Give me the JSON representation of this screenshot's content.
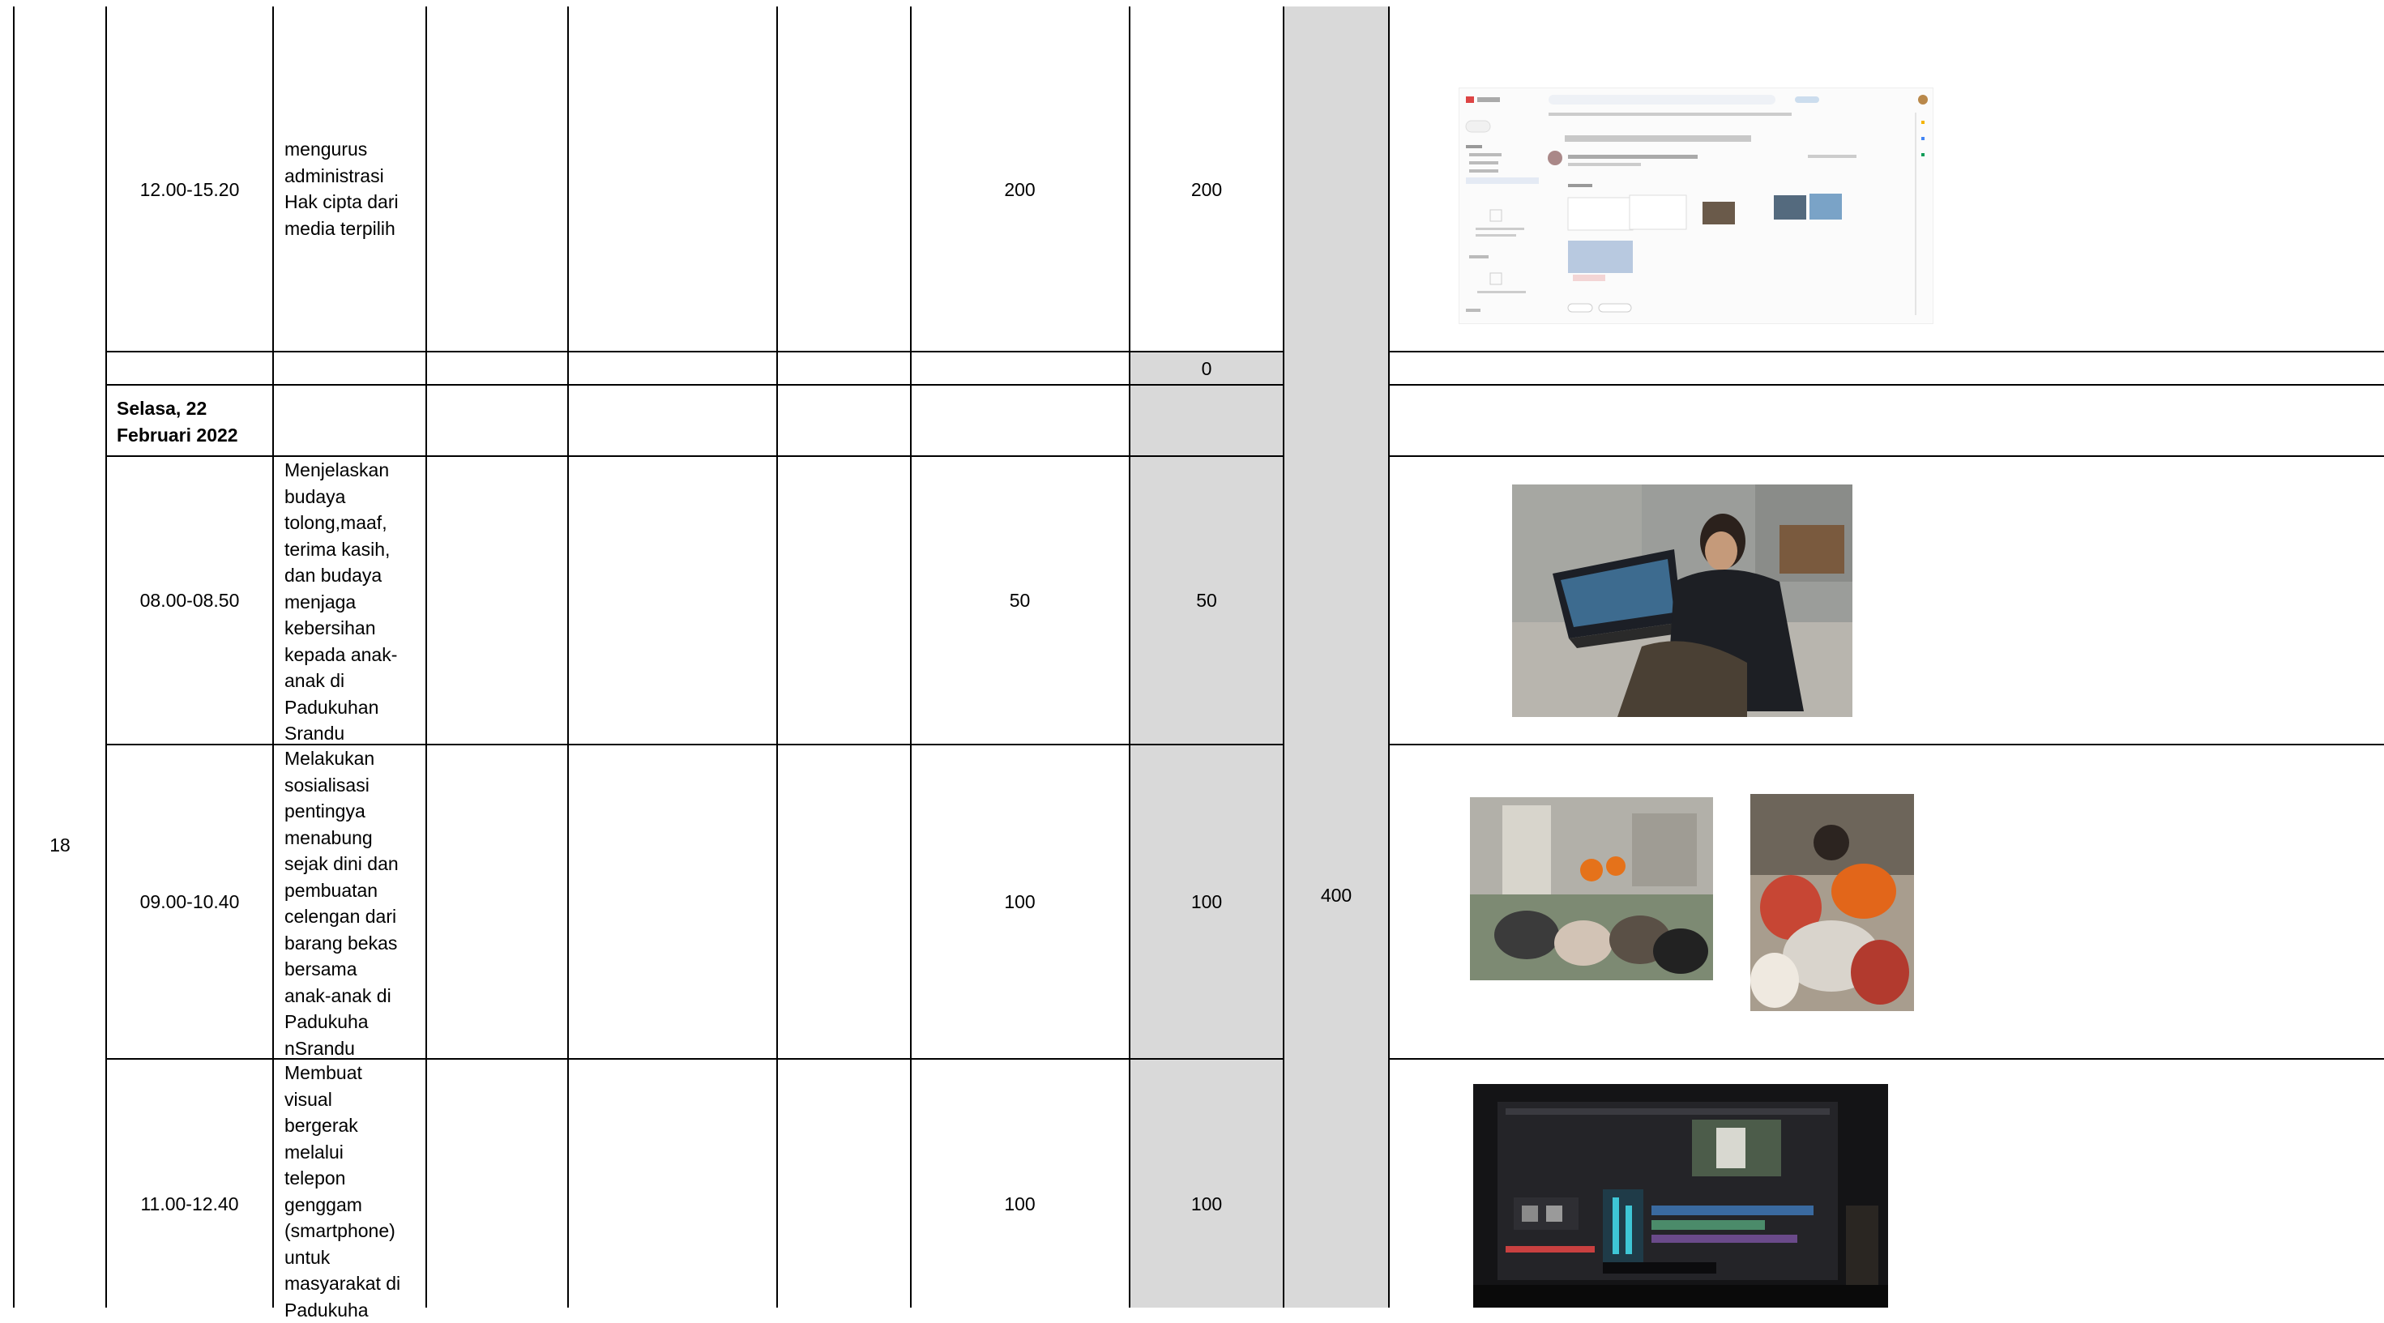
{
  "day_number": "18",
  "total": "400",
  "rows": [
    {
      "time": "12.00-15.20",
      "activity": "mengurus\nadministrasi\nHak cipta dari\nmedia terpilih",
      "value_a": "200",
      "value_b": "200",
      "photo": "email screenshot of copyright submission"
    },
    {
      "value_b": "0"
    },
    {
      "date": "Selasa, 22\nFebruari 2022"
    },
    {
      "time": "08.00-08.50",
      "activity": "Menjelaskan\nbudaya\ntolong,maaf,\nterima kasih,\ndan budaya\nmenjaga\nkebersihan\nkepada anak-\nanak di\nPadukuhan\nSrandu",
      "value_a": "50",
      "value_b": "50",
      "photo": "person holding laptop"
    },
    {
      "time": "09.00-10.40",
      "activity": "Melakukan\nsosialisasi\npentingya\nmenabung\nsejak dini dan\npembuatan\ncelengan dari\nbarang bekas\nbersama\nanak-anak di\nPadukuha\nnSrandu",
      "value_a": "100",
      "value_b": "100",
      "photo": "children activity photos"
    },
    {
      "time": "11.00-12.40",
      "activity": "Membuat\nvisual\nbergerak\nmelalui\ntelepon\ngenggam\n(smartphone)\nuntuk\nmasyarakat di\nPadukuha",
      "value_a": "100",
      "value_b": "100",
      "photo": "video editing on laptop"
    }
  ],
  "email_ui": {
    "app_name": "Gmail",
    "search_placeholder": "Cari",
    "subject": "Hak Cipta - Jelas dan Kata kunci Karya - Program Kuliah"
  }
}
